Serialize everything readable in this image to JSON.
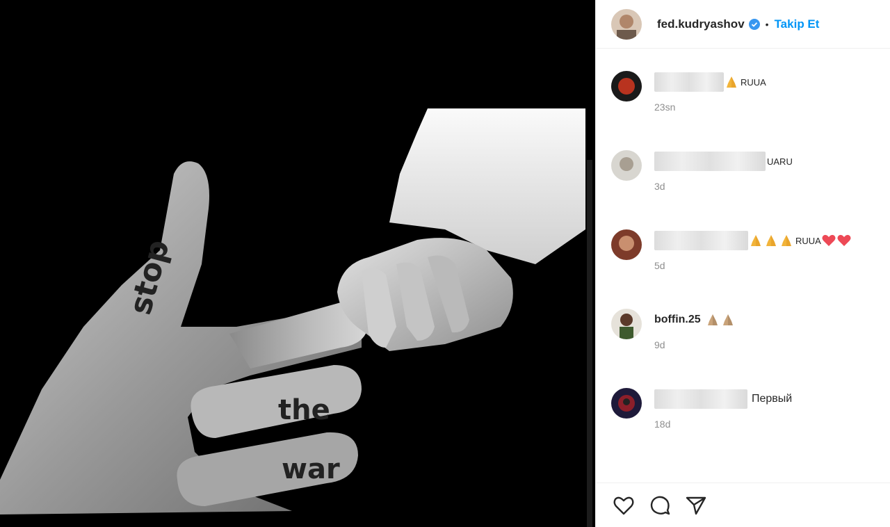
{
  "post": {
    "username": "fed.kudryashov",
    "follow_label": "Takip Et",
    "separator": "•",
    "image_text": [
      "stop",
      "the",
      "war"
    ]
  },
  "comments": [
    {
      "user": "",
      "text": "RUUA",
      "emojis": [
        "folded-hands"
      ],
      "time": "23sn"
    },
    {
      "user": "",
      "text": "UARU",
      "emojis": [],
      "time": "3d"
    },
    {
      "user": "",
      "text": "RUUA",
      "emojis_before": [
        "folded-hands",
        "folded-hands",
        "folded-hands"
      ],
      "emojis_after": [
        "red-heart",
        "red-heart"
      ],
      "time": "5d"
    },
    {
      "user": "boffin.25",
      "text": "",
      "emojis": [
        "folded-hands",
        "folded-hands"
      ],
      "time": "9d"
    },
    {
      "user": "",
      "text": "Первый",
      "emojis": [],
      "time": "18d"
    }
  ],
  "actions": [
    "heart-icon",
    "comment-icon",
    "share-icon"
  ],
  "colors": {
    "accent": "#0095f6",
    "muted": "#8e8e8e",
    "text": "#262626",
    "heart": "#ed4956"
  }
}
